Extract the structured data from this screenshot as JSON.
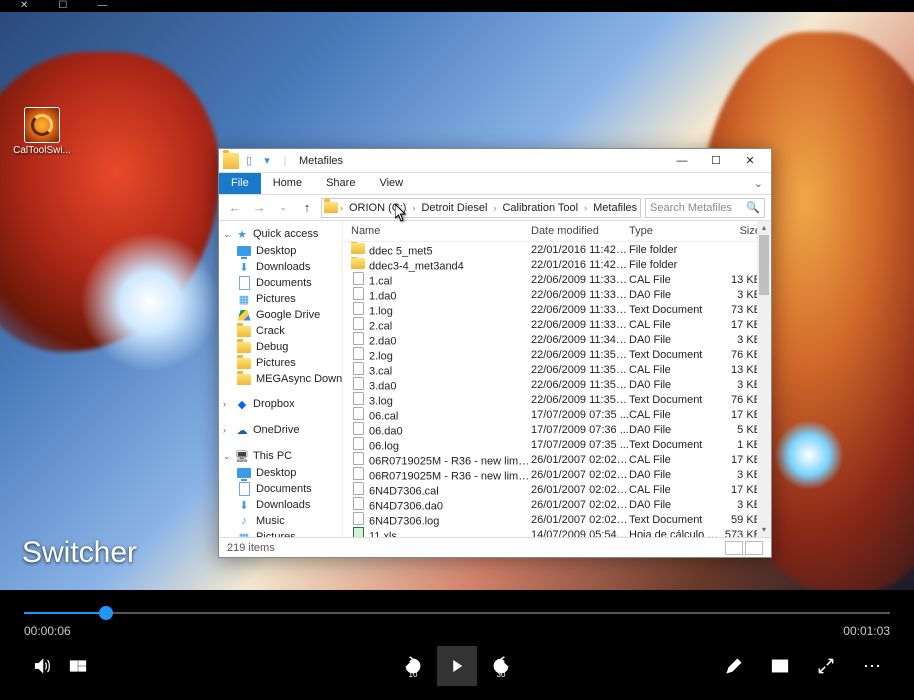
{
  "top_window": {
    "close": "✕",
    "restore": "☐",
    "min": "—"
  },
  "desktop_icon": {
    "label": "CalToolSwi..."
  },
  "explorer": {
    "title": "Metafiles",
    "ribbon": {
      "file": "File",
      "home": "Home",
      "share": "Share",
      "view": "View"
    },
    "breadcrumb": [
      "ORION (C:)",
      "Detroit Diesel",
      "Calibration Tool",
      "Metafiles"
    ],
    "search_placeholder": "Search Metafiles",
    "columns": {
      "name": "Name",
      "date": "Date modified",
      "type": "Type",
      "size": "Size"
    },
    "nav": {
      "quick": {
        "label": "Quick access",
        "items": [
          "Desktop",
          "Downloads",
          "Documents",
          "Pictures",
          "Google Drive",
          "Crack",
          "Debug",
          "Pictures",
          "MEGAsync Down"
        ]
      },
      "dropbox": "Dropbox",
      "onedrive": "OneDrive",
      "thispc": {
        "label": "This PC",
        "items": [
          "Desktop",
          "Documents",
          "Downloads",
          "Music",
          "Pictures"
        ]
      }
    },
    "files": [
      {
        "n": "ddec 5_met5",
        "d": "22/01/2016 11:42 a...",
        "t": "File folder",
        "s": "",
        "k": "folder"
      },
      {
        "n": "ddec3-4_met3and4",
        "d": "22/01/2016 11:42 a...",
        "t": "File folder",
        "s": "",
        "k": "folder"
      },
      {
        "n": "1.cal",
        "d": "22/06/2009 11:33 a...",
        "t": "CAL File",
        "s": "13 KB",
        "k": "file"
      },
      {
        "n": "1.da0",
        "d": "22/06/2009 11:33 a...",
        "t": "DA0 File",
        "s": "3 KB",
        "k": "file"
      },
      {
        "n": "1.log",
        "d": "22/06/2009 11:33 a...",
        "t": "Text Document",
        "s": "73 KB",
        "k": "file"
      },
      {
        "n": "2.cal",
        "d": "22/06/2009 11:33 a...",
        "t": "CAL File",
        "s": "17 KB",
        "k": "file"
      },
      {
        "n": "2.da0",
        "d": "22/06/2009 11:34 a...",
        "t": "DA0 File",
        "s": "3 KB",
        "k": "file"
      },
      {
        "n": "2.log",
        "d": "22/06/2009 11:35 a...",
        "t": "Text Document",
        "s": "76 KB",
        "k": "file"
      },
      {
        "n": "3.cal",
        "d": "22/06/2009 11:35 a...",
        "t": "CAL File",
        "s": "13 KB",
        "k": "file"
      },
      {
        "n": "3.da0",
        "d": "22/06/2009 11:35 a...",
        "t": "DA0 File",
        "s": "3 KB",
        "k": "file"
      },
      {
        "n": "3.log",
        "d": "22/06/2009 11:35 a...",
        "t": "Text Document",
        "s": "76 KB",
        "k": "file"
      },
      {
        "n": "06.cal",
        "d": "17/07/2009 07:35 ...",
        "t": "CAL File",
        "s": "17 KB",
        "k": "file"
      },
      {
        "n": "06.da0",
        "d": "17/07/2009 07:36 ...",
        "t": "DA0 File",
        "s": "5 KB",
        "k": "file"
      },
      {
        "n": "06.log",
        "d": "17/07/2009 07:35 ...",
        "t": "Text Document",
        "s": "1 KB",
        "k": "file"
      },
      {
        "n": "06R0719025M - R36 - new limits.cal",
        "d": "26/01/2007 02:02 a...",
        "t": "CAL File",
        "s": "17 KB",
        "k": "file"
      },
      {
        "n": "06R0719025M - R36 - new limits.da0",
        "d": "26/01/2007 02:02 a...",
        "t": "DA0 File",
        "s": "3 KB",
        "k": "file"
      },
      {
        "n": "6N4D7306.cal",
        "d": "26/01/2007 02:02 a...",
        "t": "CAL File",
        "s": "17 KB",
        "k": "file"
      },
      {
        "n": "6N4D7306.da0",
        "d": "26/01/2007 02:02 a...",
        "t": "DA0 File",
        "s": "3 KB",
        "k": "file"
      },
      {
        "n": "6N4D7306.log",
        "d": "26/01/2007 02:02 a...",
        "t": "Text Document",
        "s": "59 KB",
        "k": "file"
      },
      {
        "n": "11.xls",
        "d": "14/07/2009 05:54 a...",
        "t": "Hoja de cálculo d...",
        "s": "573 KB",
        "k": "xls"
      }
    ],
    "status": "219 items"
  },
  "video": {
    "title": "Switcher",
    "current": "00:00:06",
    "duration": "00:01:03",
    "progress_pct": 9.5,
    "skip_back": "10",
    "skip_fwd": "30"
  }
}
